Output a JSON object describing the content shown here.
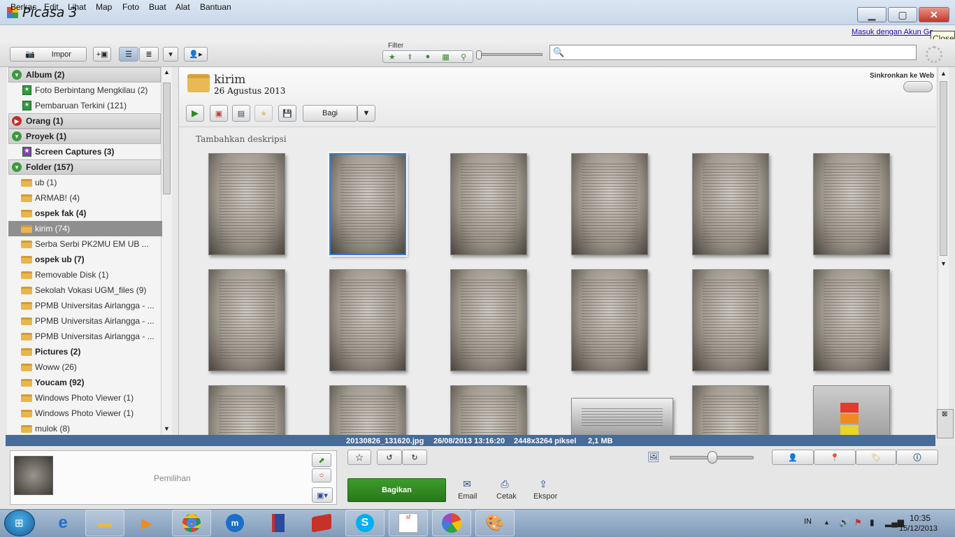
{
  "window": {
    "title": "Picasa 3",
    "tooltip": "Close"
  },
  "menu": [
    "Berkas",
    "Edit",
    "Lihat",
    "Map",
    "Foto",
    "Buat",
    "Alat",
    "Bantuan"
  ],
  "signin_link": "Masuk dengan Akun Go",
  "toolbar": {
    "import_label": "Impor",
    "filter_label": "Filter",
    "search_placeholder": ""
  },
  "sidebar": {
    "sections": [
      {
        "title": "Album (2)",
        "color": "#3a9b3e",
        "items": [
          {
            "label": "Foto Berbintang Mengkilau (2)"
          },
          {
            "label": "Pembaruan Terkini (121)"
          }
        ]
      },
      {
        "title": "Orang (1)",
        "color": "#c03030",
        "items": []
      },
      {
        "title": "Proyek (1)",
        "color": "#3a9b3e",
        "items": [
          {
            "label": "Screen Captures (3)"
          }
        ]
      },
      {
        "title": "Folder (157)",
        "color": "#3a9b3e",
        "items": [
          {
            "label": "ub (1)"
          },
          {
            "label": "ARMAB! (4)"
          },
          {
            "label": "ospek fak (4)"
          },
          {
            "label": "kirim (74)"
          },
          {
            "label": "Serba Serbi PK2MU   EM UB ..."
          },
          {
            "label": "ospek ub (7)"
          },
          {
            "label": "Removable Disk (1)"
          },
          {
            "label": "Sekolah Vokasi UGM_files (9)"
          },
          {
            "label": "PPMB Universitas Airlangga - ..."
          },
          {
            "label": "PPMB Universitas Airlangga - ..."
          },
          {
            "label": "PPMB Universitas Airlangga - ..."
          },
          {
            "label": "Pictures (2)"
          },
          {
            "label": "Woww (26)"
          },
          {
            "label": "Youcam (92)"
          },
          {
            "label": "Windows Photo Viewer (1)"
          },
          {
            "label": "Windows Photo Viewer (1)"
          },
          {
            "label": "mulok (8)"
          }
        ]
      }
    ]
  },
  "main": {
    "folder_name": "kirim",
    "folder_date": "26 Agustus 2013",
    "share_label": "Bagi",
    "sync_label": "Sinkronkan ke Web",
    "description_placeholder": "Tambahkan deskripsi"
  },
  "status": {
    "filename": "20130826_131620.jpg",
    "datetime": "26/08/2013 13:16:20",
    "dimensions": "2448x3264 piksel",
    "size": "2,1 MB"
  },
  "bottom": {
    "tray_label": "Pemilihan",
    "share_button": "Bagikan",
    "actions": [
      "Email",
      "Cetak",
      "Ekspor"
    ]
  },
  "taskbar": {
    "language": "IN",
    "time": "10:35",
    "date": "15/12/2013"
  }
}
